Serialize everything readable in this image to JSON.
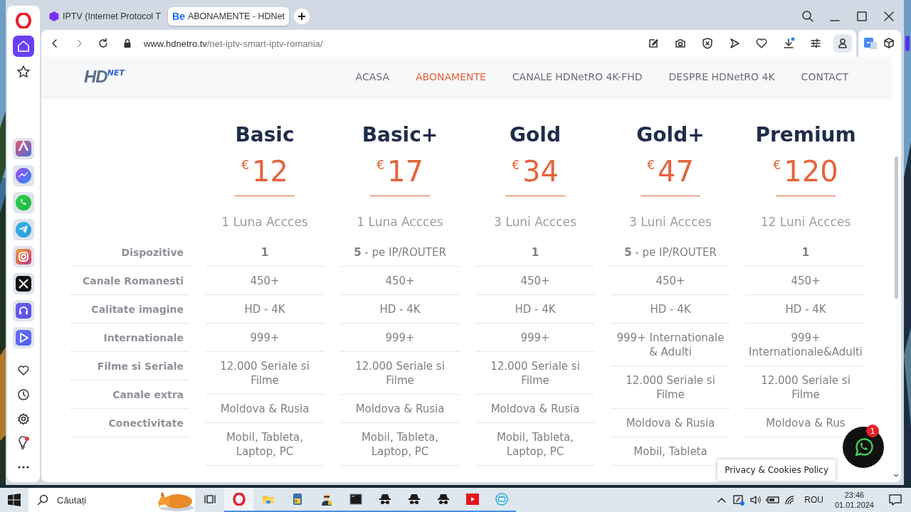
{
  "browser": {
    "tabs": [
      {
        "title": "IPTV (Internet Protocol T",
        "selected": false
      },
      {
        "title": "ABONAMENTE - HDNet",
        "favicon_text": "Be",
        "selected": true
      }
    ],
    "url": {
      "domain": "www.hdnetro.tv",
      "path": "/net-iptv-smart-iptv-romania/"
    }
  },
  "site": {
    "logo": {
      "main": "HD",
      "sup": "NET"
    },
    "nav": [
      {
        "label": "ACASA",
        "selected": false
      },
      {
        "label": "ABONAMENTE",
        "selected": true
      },
      {
        "label": "CANALE HDNetRO 4K-FHD",
        "selected": false
      },
      {
        "label": "DESPRE HDNetRO 4K",
        "selected": false
      },
      {
        "label": "CONTACT",
        "selected": false
      }
    ],
    "features": [
      "Dispozitive",
      "Canale Romanesti",
      "Calitate imagine",
      "Internationale",
      "Filme si Seriale",
      "Canale extra",
      "Conectivitate"
    ],
    "plans": [
      {
        "name": "Basic",
        "currency": "€",
        "price": "12",
        "period": "1 Luna Accces",
        "cells": [
          {
            "text": "1",
            "bold": true
          },
          {
            "text": "450+"
          },
          {
            "text": "HD - 4K"
          },
          {
            "text": "999+"
          },
          {
            "text": "12.000 Seriale si Filme"
          },
          {
            "text": "Moldova & Rusia"
          },
          {
            "text": "Mobil, Tableta, Laptop, PC"
          }
        ]
      },
      {
        "name": "Basic+",
        "currency": "€",
        "price": "17",
        "period": "1 Luna Accces",
        "cells": [
          {
            "text": "**5** - pe IP/ROUTER"
          },
          {
            "text": "450+"
          },
          {
            "text": "HD - 4K"
          },
          {
            "text": "999+"
          },
          {
            "text": "12.000 Seriale si Filme"
          },
          {
            "text": "Moldova & Rusia"
          },
          {
            "text": "Mobil, Tableta, Laptop, PC"
          }
        ]
      },
      {
        "name": "Gold",
        "currency": "€",
        "price": "34",
        "period": "3 Luni Accces",
        "cells": [
          {
            "text": "1",
            "bold": true
          },
          {
            "text": "450+"
          },
          {
            "text": "HD - 4K"
          },
          {
            "text": "999+"
          },
          {
            "text": "12.000 Seriale si Filme"
          },
          {
            "text": "Moldova & Rusia"
          },
          {
            "text": "Mobil, Tableta, Laptop, PC"
          }
        ]
      },
      {
        "name": "Gold+",
        "currency": "€",
        "price": "47",
        "period": "3 Luni Accces",
        "cells": [
          {
            "text": "**5** - pe IP/ROUTER"
          },
          {
            "text": "450+"
          },
          {
            "text": "HD - 4K"
          },
          {
            "text": "999+ Internationale & Adulti"
          },
          {
            "text": "12.000 Seriale si Filme"
          },
          {
            "text": "Moldova & Rusia"
          },
          {
            "text": "Mobil, Tableta"
          }
        ]
      },
      {
        "name": "Premium",
        "currency": "€",
        "price": "120",
        "period": "12 Luni Accces",
        "cells": [
          {
            "text": "1",
            "bold": true
          },
          {
            "text": "450+"
          },
          {
            "text": "HD - 4K"
          },
          {
            "text": "999+ Internationale&Adulti"
          },
          {
            "text": "12.000 Seriale si Filme"
          },
          {
            "text": "Moldova & Rus"
          }
        ]
      }
    ],
    "chat_badge": "1",
    "privacy": "Privacy & Cookies Policy"
  },
  "taskbar": {
    "search_placeholder": "Căutați",
    "apps": [
      {
        "kind": "taskview",
        "running": false,
        "selected": false
      },
      {
        "kind": "opera",
        "running": true,
        "selected": true
      },
      {
        "kind": "folder",
        "running": true,
        "selected": false
      },
      {
        "kind": "python",
        "running": true,
        "selected": false
      },
      {
        "kind": "agent",
        "running": true,
        "selected": false
      },
      {
        "kind": "terminal",
        "running": true,
        "selected": false
      },
      {
        "kind": "hat",
        "running": true,
        "selected": false
      },
      {
        "kind": "hat",
        "running": true,
        "selected": false
      },
      {
        "kind": "hat",
        "running": true,
        "selected": false
      },
      {
        "kind": "youtube",
        "running": true,
        "selected": false
      },
      {
        "kind": "tv",
        "running": true,
        "selected": false
      }
    ],
    "language": "ROU",
    "time": "23:46",
    "date": "01.01.2024"
  }
}
